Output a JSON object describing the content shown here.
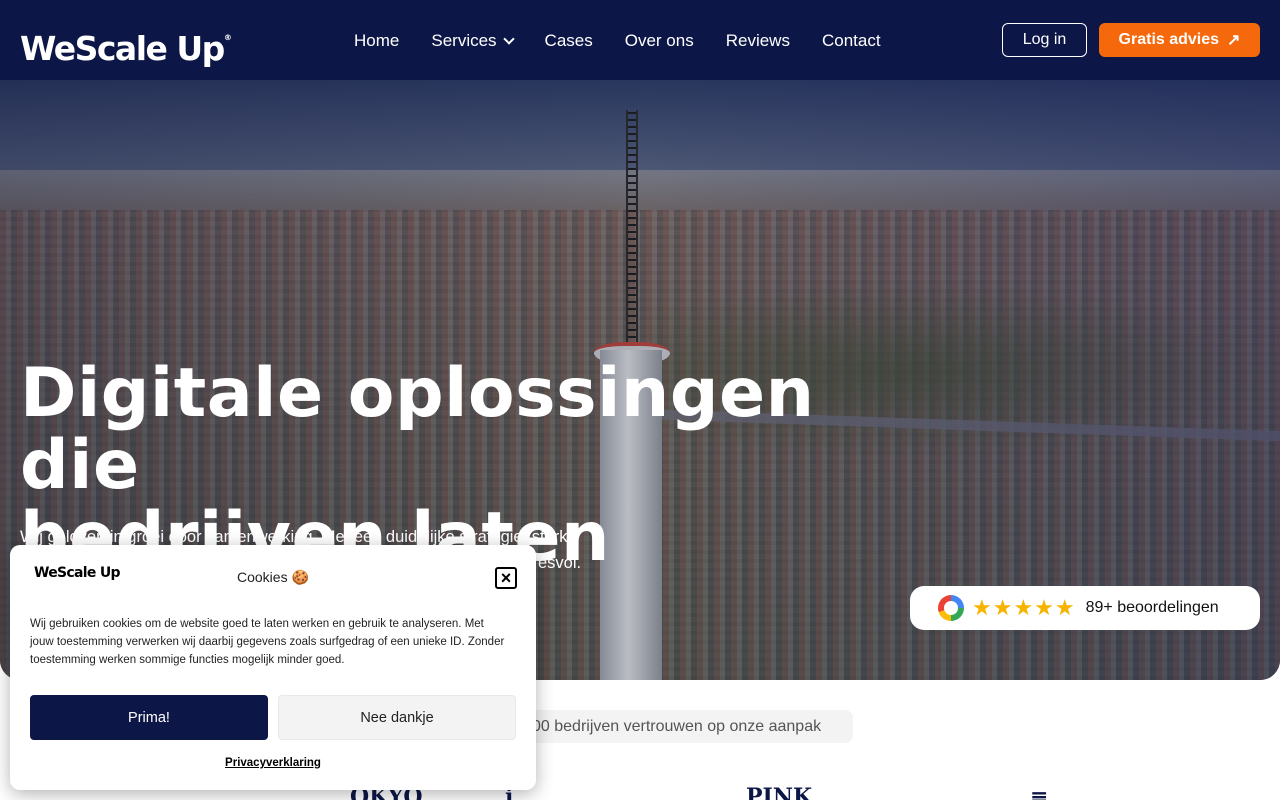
{
  "header": {
    "logo": "WeScale Up",
    "logo_mark": "®",
    "nav": [
      "Home",
      "Services",
      "Cases",
      "Over ons",
      "Reviews",
      "Contact"
    ],
    "login_label": "Log in",
    "cta_label": "Gratis advies",
    "cta_icon": "↗"
  },
  "hero": {
    "title_line1": "Digitale oplossingen die",
    "title_line2": "bedrijven laten groeien",
    "subtitle": "Wij geloven in groei door samenwerking. Met een duidelijke strategie, sterke ... esvol.",
    "subtitle_visible_line1": "Wij geloven in groei door samenwerking. Met een duidelijke strategie, sterke",
    "subtitle_visible_line2": "esvol.",
    "reviews": {
      "stars": "★★★★★",
      "rating_count": 5,
      "label": "89+ beoordelingen"
    }
  },
  "trust": {
    "text": "00 bedrijven vertrouwen op onze aanpak",
    "client_logos": [
      "OKYO",
      "i",
      "PINK",
      "≡"
    ]
  },
  "cookie": {
    "logo": "WeScale Up",
    "title": "Cookies 🍪",
    "close": "×",
    "text": "Wij gebruiken cookies om de website goed te laten werken en gebruik te analyseren. Met jouw toestemming verwerken wij daarbij gegevens zoals surfgedrag of een unieke ID. Zonder toestemming werken sommige functies mogelijk minder goed.",
    "accept_label": "Prima!",
    "decline_label": "Nee dankje",
    "privacy_label": "Privacyverklaring"
  },
  "colors": {
    "navy": "#0d1747",
    "orange": "#f5680b",
    "star": "#f6b400"
  }
}
